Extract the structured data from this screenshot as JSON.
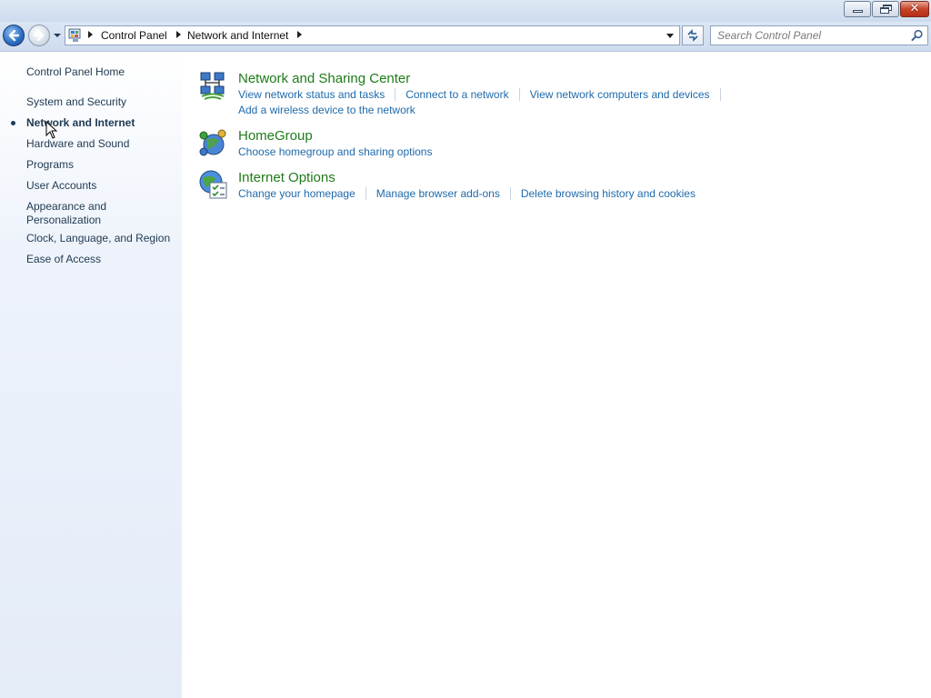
{
  "window": {
    "min_label": "",
    "restore_label": "",
    "close_label": "✕"
  },
  "address": {
    "crumbs": [
      "Control Panel",
      "Network and Internet"
    ]
  },
  "search": {
    "placeholder": "Search Control Panel"
  },
  "sidebar": {
    "items": [
      {
        "label": "Control Panel Home"
      },
      {
        "label": "System and Security"
      },
      {
        "label": "Network and Internet",
        "current": true
      },
      {
        "label": "Hardware and Sound"
      },
      {
        "label": "Programs"
      },
      {
        "label": "User Accounts"
      },
      {
        "label": "Appearance and Personalization"
      },
      {
        "label": "Clock, Language, and Region"
      },
      {
        "label": "Ease of Access"
      }
    ]
  },
  "categories": [
    {
      "title": "Network and Sharing Center",
      "icon": "network-sharing-icon",
      "tasks": [
        "View network status and tasks",
        "Connect to a network",
        "View network computers and devices",
        "Add a wireless device to the network"
      ]
    },
    {
      "title": "HomeGroup",
      "icon": "homegroup-icon",
      "tasks": [
        "Choose homegroup and sharing options"
      ]
    },
    {
      "title": "Internet Options",
      "icon": "internet-options-icon",
      "tasks": [
        "Change your homepage",
        "Manage browser add-ons",
        "Delete browsing history and cookies"
      ]
    }
  ],
  "colors": {
    "category_title": "#1e7b18",
    "task_link": "#1e6aab",
    "sidebar_text": "#1e3951"
  }
}
